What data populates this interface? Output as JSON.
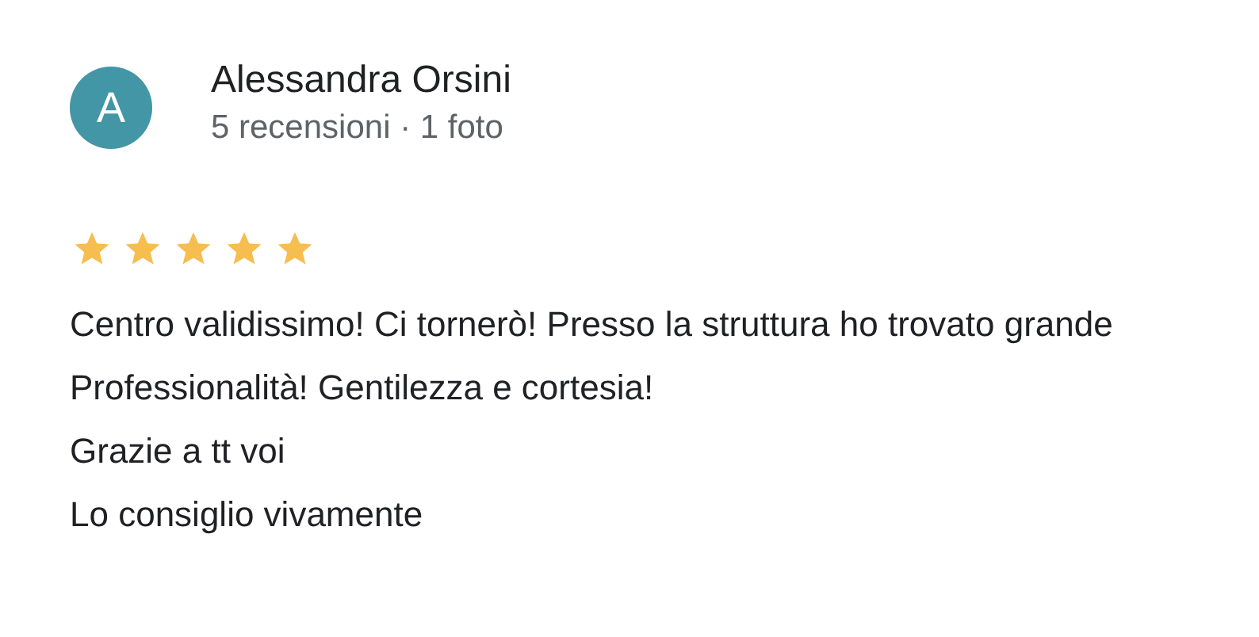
{
  "review": {
    "author": {
      "initial": "A",
      "name": "Alessandra Orsini",
      "meta": "5 recensioni · 1 foto"
    },
    "stars": 5,
    "paragraphs": [
      "Centro validissimo! Ci tornerò! Presso la struttura ho trovato grande Professionalità! Gentilezza e cortesia!",
      "Grazie a tt voi",
      "Lo consiglio vivamente"
    ]
  }
}
